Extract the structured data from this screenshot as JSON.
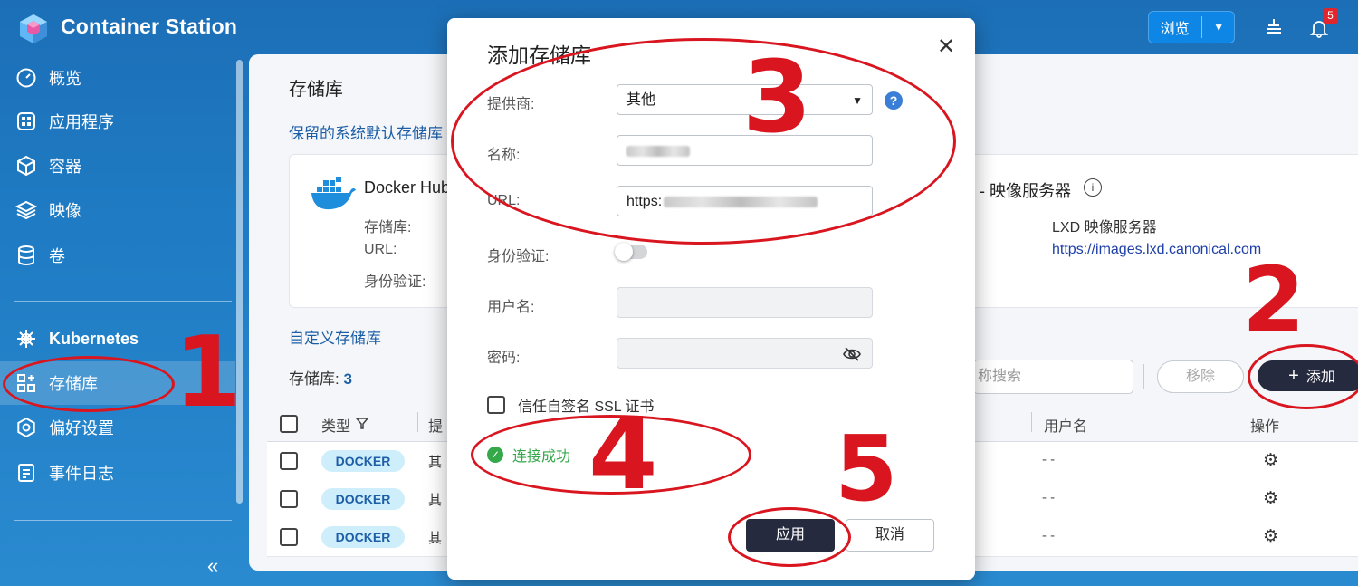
{
  "app": {
    "title": "Container Station"
  },
  "topbar": {
    "browse_label": "浏览",
    "notification_count": "5"
  },
  "sidebar": {
    "items": [
      {
        "label": "概览",
        "icon": "gauge-icon"
      },
      {
        "label": "应用程序",
        "icon": "apps-grid-icon"
      },
      {
        "label": "容器",
        "icon": "cube-icon"
      },
      {
        "label": "映像",
        "icon": "layers-icon"
      },
      {
        "label": "卷",
        "icon": "database-icon"
      },
      {
        "label": "Kubernetes",
        "icon": "helm-wheel-icon"
      },
      {
        "label": "存储库",
        "icon": "repository-grid-icon",
        "active": true
      },
      {
        "label": "偏好设置",
        "icon": "gear-icon"
      },
      {
        "label": "事件日志",
        "icon": "log-icon"
      }
    ]
  },
  "main": {
    "page_title": "存储库",
    "reserved_title": "保留的系统默认存储库",
    "docker_card": {
      "name": "Docker Hub",
      "label_repository": "存储库:",
      "label_url": "URL:",
      "label_auth": "身份验证:"
    },
    "lxd_card": {
      "name": "- 映像服务器",
      "repository": "LXD 映像服务器",
      "url": "https://images.lxd.canonical.com"
    },
    "custom_title": "自定义存储库",
    "count_label": "存储库:",
    "count_value": "3",
    "search_placeholder": "称搜索",
    "remove_label": "移除",
    "add_label": "添加",
    "table": {
      "columns": {
        "type": "类型",
        "provider": "提",
        "username": "用户名",
        "actions": "操作"
      },
      "rows": [
        {
          "type": "DOCKER",
          "provider": "其",
          "username": "- -"
        },
        {
          "type": "DOCKER",
          "provider": "其",
          "username": "- -"
        },
        {
          "type": "DOCKER",
          "provider": "其",
          "username": "- -"
        }
      ]
    }
  },
  "modal": {
    "title": "添加存储库",
    "provider_label": "提供商:",
    "provider_value": "其他",
    "name_label": "名称:",
    "url_label": "URL:",
    "url_value": "https:",
    "auth_label": "身份验证:",
    "username_label": "用户名:",
    "password_label": "密码:",
    "ssl_label": "信任自签名 SSL 证书",
    "status_text": "连接成功",
    "apply_label": "应用",
    "cancel_label": "取消"
  },
  "annotations": [
    "1",
    "2",
    "3",
    "4",
    "5"
  ],
  "colors": {
    "accent": "#1d5fa7",
    "annotation": "#d9161f",
    "success": "#35a84a",
    "primary_button": "#262a3f"
  }
}
